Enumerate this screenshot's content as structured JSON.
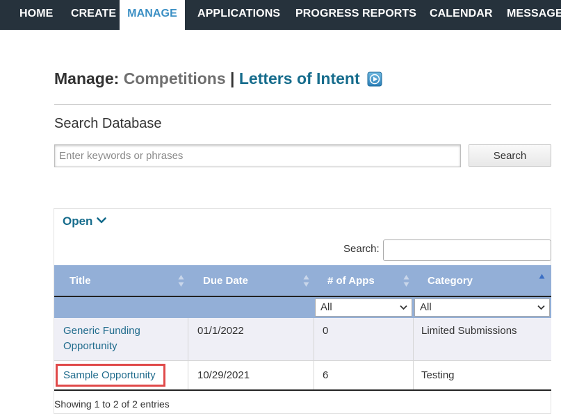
{
  "nav": {
    "items": [
      {
        "label": "HOME"
      },
      {
        "label": "CREATE"
      },
      {
        "label": "MANAGE",
        "active": true
      },
      {
        "label": "APPLICATIONS"
      },
      {
        "label": "PROGRESS REPORTS"
      },
      {
        "label": "CALENDAR"
      },
      {
        "label": "MESSAGES"
      }
    ]
  },
  "heading": {
    "label": "Manage:",
    "competitions": "Competitions",
    "separator": "|",
    "letters_of_intent": "Letters of Intent",
    "icon": "play-icon"
  },
  "search_db": {
    "title": "Search Database",
    "placeholder": "Enter keywords or phrases",
    "value": "",
    "button_label": "Search"
  },
  "panel": {
    "toggle_label": "Open",
    "toggle_icon": "chevron-down-icon",
    "search_label": "Search:",
    "search_value": ""
  },
  "table": {
    "columns": [
      {
        "label": "Title",
        "sort": "both"
      },
      {
        "label": "Due Date",
        "sort": "both"
      },
      {
        "label": "# of Apps",
        "sort": "both"
      },
      {
        "label": "Category",
        "sort": "asc"
      }
    ],
    "filters": {
      "apps": "All",
      "category": "All"
    },
    "rows": [
      {
        "title": "Generic Funding Opportunity",
        "title_line1": "Generic Funding",
        "title_line2": "Opportunity",
        "due_date": "01/1/2022",
        "apps": "0",
        "category": "Limited Submissions"
      },
      {
        "title": "Sample Opportunity",
        "due_date": "10/29/2021",
        "apps": "6",
        "category": "Testing",
        "highlighted": true
      }
    ],
    "info": "Showing 1 to 2 of 2 entries"
  },
  "colors": {
    "nav_bg": "#26323c",
    "nav_active_text": "#3b8fc4",
    "link": "#166c8c",
    "header_bg": "#93afd7",
    "row_alt": "#efeff6",
    "highlight": "#e04a4a"
  }
}
